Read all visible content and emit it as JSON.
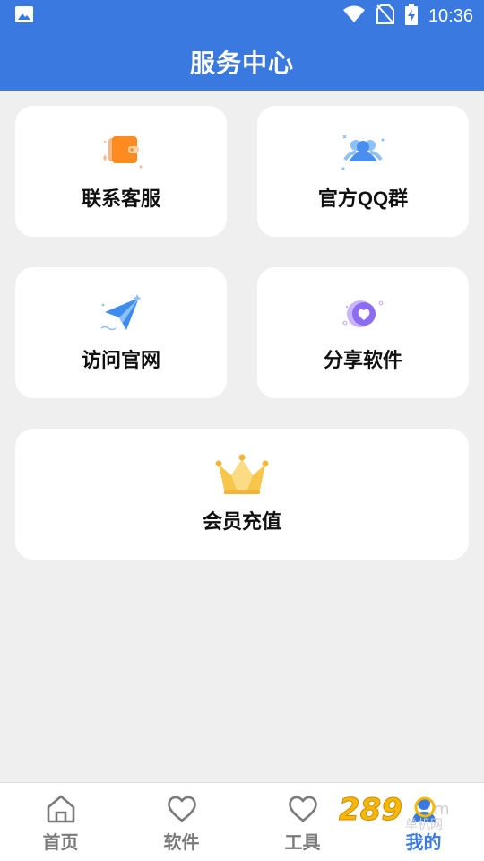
{
  "status_bar": {
    "time": "10:36",
    "icons": [
      "image-icon",
      "wifi-icon",
      "no-sim-icon",
      "battery-charging-icon"
    ]
  },
  "header": {
    "title": "服务中心"
  },
  "cards": [
    {
      "label": "联系客服",
      "icon": "wallet-icon"
    },
    {
      "label": "官方QQ群",
      "icon": "group-icon"
    },
    {
      "label": "访问官网",
      "icon": "paper-plane-icon"
    },
    {
      "label": "分享软件",
      "icon": "heart-share-icon"
    },
    {
      "label": "会员充值",
      "icon": "crown-icon"
    }
  ],
  "bottom_nav": {
    "items": [
      {
        "label": "首页",
        "icon": "home-icon",
        "active": false
      },
      {
        "label": "软件",
        "icon": "heart-icon",
        "active": false
      },
      {
        "label": "工具",
        "icon": "heart-icon",
        "active": false
      },
      {
        "label": "我的",
        "icon": "user-icon",
        "active": true
      }
    ]
  },
  "colors": {
    "primary": "#3a7ae0",
    "background": "#efefef",
    "card": "#ffffff",
    "nav_inactive": "#7a7a7a"
  }
}
